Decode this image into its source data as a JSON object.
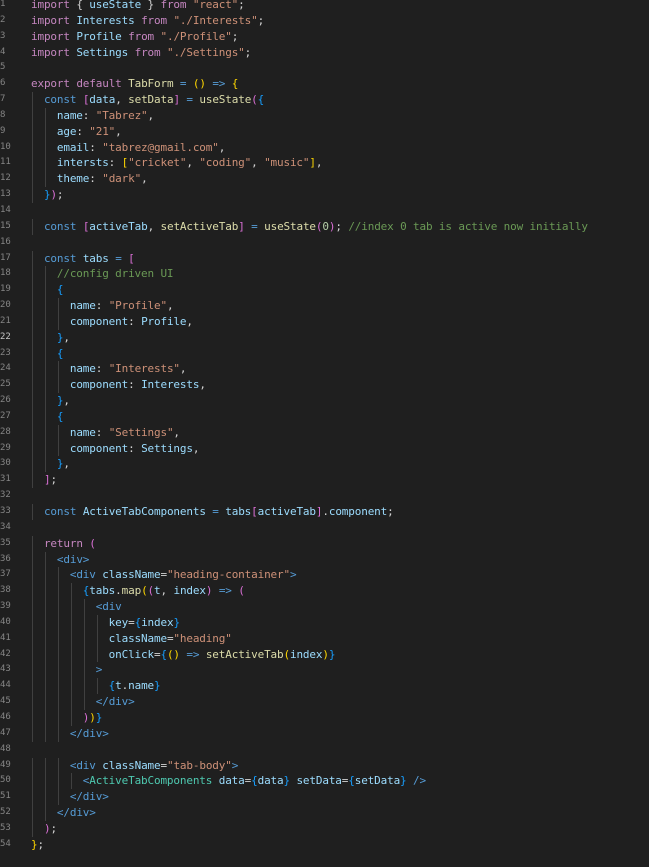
{
  "editor": {
    "language": "javascript",
    "theme": "dark",
    "current_line": 22,
    "colors": {
      "background": "#1f1f1f",
      "line_number": "#858585",
      "text": "#d4d4d4",
      "keyword_control": "#c586c0",
      "keyword": "#569cd6",
      "variable": "#9cdcfe",
      "function": "#dcdcaa",
      "string": "#ce9178",
      "number": "#b5cea8",
      "comment": "#6a9955",
      "component": "#4ec9b0",
      "tag": "#569cd6",
      "bracket_1": "#ffd700",
      "bracket_2": "#da70d6",
      "bracket_3": "#179fff"
    },
    "lines": [
      [
        [
          "import",
          "kc"
        ],
        [
          " { ",
          "p"
        ],
        [
          "useState",
          "v"
        ],
        [
          " } ",
          "p"
        ],
        [
          "from",
          "kc"
        ],
        [
          " ",
          "p"
        ],
        [
          "\"react\"",
          "s"
        ],
        [
          ";",
          "p"
        ]
      ],
      [
        [
          "import",
          "kc"
        ],
        [
          " ",
          "p"
        ],
        [
          "Interests",
          "v"
        ],
        [
          " ",
          "p"
        ],
        [
          "from",
          "kc"
        ],
        [
          " ",
          "p"
        ],
        [
          "\"./Interests\"",
          "s"
        ],
        [
          ";",
          "p"
        ]
      ],
      [
        [
          "import",
          "kc"
        ],
        [
          " ",
          "p"
        ],
        [
          "Profile",
          "v"
        ],
        [
          " ",
          "p"
        ],
        [
          "from",
          "kc"
        ],
        [
          " ",
          "p"
        ],
        [
          "\"./Profile\"",
          "s"
        ],
        [
          ";",
          "p"
        ]
      ],
      [
        [
          "import",
          "kc"
        ],
        [
          " ",
          "p"
        ],
        [
          "Settings",
          "v"
        ],
        [
          " ",
          "p"
        ],
        [
          "from",
          "kc"
        ],
        [
          " ",
          "p"
        ],
        [
          "\"./Settings\"",
          "s"
        ],
        [
          ";",
          "p"
        ]
      ],
      [],
      [
        [
          "export",
          "kc"
        ],
        [
          " ",
          "p"
        ],
        [
          "default",
          "kc"
        ],
        [
          " ",
          "p"
        ],
        [
          "TabForm",
          "f"
        ],
        [
          " ",
          "p"
        ],
        [
          "=",
          "k"
        ],
        [
          " ",
          "p"
        ],
        [
          "()",
          "b1"
        ],
        [
          " ",
          "p"
        ],
        [
          "=>",
          "k"
        ],
        [
          " ",
          "p"
        ],
        [
          "{",
          "b1"
        ]
      ],
      [
        [
          "  ",
          "p"
        ],
        [
          "const",
          "k"
        ],
        [
          " ",
          "p"
        ],
        [
          "[",
          "b2"
        ],
        [
          "data",
          "v"
        ],
        [
          ", ",
          "p"
        ],
        [
          "setData",
          "f"
        ],
        [
          "]",
          "b2"
        ],
        [
          " ",
          "p"
        ],
        [
          "=",
          "k"
        ],
        [
          " ",
          "p"
        ],
        [
          "useState",
          "f"
        ],
        [
          "(",
          "b2"
        ],
        [
          "{",
          "b3"
        ]
      ],
      [
        [
          "    ",
          "p"
        ],
        [
          "name",
          "v"
        ],
        [
          ": ",
          "p"
        ],
        [
          "\"Tabrez\"",
          "s"
        ],
        [
          ",",
          "p"
        ]
      ],
      [
        [
          "    ",
          "p"
        ],
        [
          "age",
          "v"
        ],
        [
          ": ",
          "p"
        ],
        [
          "\"21\"",
          "s"
        ],
        [
          ",",
          "p"
        ]
      ],
      [
        [
          "    ",
          "p"
        ],
        [
          "email",
          "v"
        ],
        [
          ": ",
          "p"
        ],
        [
          "\"tabrez@gmail.com\"",
          "s"
        ],
        [
          ",",
          "p"
        ]
      ],
      [
        [
          "    ",
          "p"
        ],
        [
          "intersts",
          "v"
        ],
        [
          ": ",
          "p"
        ],
        [
          "[",
          "b1"
        ],
        [
          "\"cricket\"",
          "s"
        ],
        [
          ", ",
          "p"
        ],
        [
          "\"coding\"",
          "s"
        ],
        [
          ", ",
          "p"
        ],
        [
          "\"music\"",
          "s"
        ],
        [
          "]",
          "b1"
        ],
        [
          ",",
          "p"
        ]
      ],
      [
        [
          "    ",
          "p"
        ],
        [
          "theme",
          "v"
        ],
        [
          ": ",
          "p"
        ],
        [
          "\"dark\"",
          "s"
        ],
        [
          ",",
          "p"
        ]
      ],
      [
        [
          "  ",
          "p"
        ],
        [
          "}",
          "b3"
        ],
        [
          ")",
          "b2"
        ],
        [
          ";",
          "p"
        ]
      ],
      [],
      [
        [
          "  ",
          "p"
        ],
        [
          "const",
          "k"
        ],
        [
          " ",
          "p"
        ],
        [
          "[",
          "b2"
        ],
        [
          "activeTab",
          "v"
        ],
        [
          ", ",
          "p"
        ],
        [
          "setActiveTab",
          "f"
        ],
        [
          "]",
          "b2"
        ],
        [
          " ",
          "p"
        ],
        [
          "=",
          "k"
        ],
        [
          " ",
          "p"
        ],
        [
          "useState",
          "f"
        ],
        [
          "(",
          "b2"
        ],
        [
          "0",
          "n"
        ],
        [
          ")",
          "b2"
        ],
        [
          "; ",
          "p"
        ],
        [
          "//index 0 tab is active now initially",
          "c"
        ]
      ],
      [],
      [
        [
          "  ",
          "p"
        ],
        [
          "const",
          "k"
        ],
        [
          " ",
          "p"
        ],
        [
          "tabs",
          "v"
        ],
        [
          " ",
          "p"
        ],
        [
          "=",
          "k"
        ],
        [
          " ",
          "p"
        ],
        [
          "[",
          "b2"
        ]
      ],
      [
        [
          "    ",
          "p"
        ],
        [
          "//config driven UI",
          "c"
        ]
      ],
      [
        [
          "    ",
          "p"
        ],
        [
          "{",
          "b3"
        ]
      ],
      [
        [
          "      ",
          "p"
        ],
        [
          "name",
          "v"
        ],
        [
          ": ",
          "p"
        ],
        [
          "\"Profile\"",
          "s"
        ],
        [
          ",",
          "p"
        ]
      ],
      [
        [
          "      ",
          "p"
        ],
        [
          "component",
          "v"
        ],
        [
          ": ",
          "p"
        ],
        [
          "Profile",
          "v"
        ],
        [
          ",",
          "p"
        ]
      ],
      [
        [
          "    ",
          "p"
        ],
        [
          "}",
          "b3"
        ],
        [
          ",",
          "p"
        ]
      ],
      [
        [
          "    ",
          "p"
        ],
        [
          "{",
          "b3"
        ]
      ],
      [
        [
          "      ",
          "p"
        ],
        [
          "name",
          "v"
        ],
        [
          ": ",
          "p"
        ],
        [
          "\"Interests\"",
          "s"
        ],
        [
          ",",
          "p"
        ]
      ],
      [
        [
          "      ",
          "p"
        ],
        [
          "component",
          "v"
        ],
        [
          ": ",
          "p"
        ],
        [
          "Interests",
          "v"
        ],
        [
          ",",
          "p"
        ]
      ],
      [
        [
          "    ",
          "p"
        ],
        [
          "}",
          "b3"
        ],
        [
          ",",
          "p"
        ]
      ],
      [
        [
          "    ",
          "p"
        ],
        [
          "{",
          "b3"
        ]
      ],
      [
        [
          "      ",
          "p"
        ],
        [
          "name",
          "v"
        ],
        [
          ": ",
          "p"
        ],
        [
          "\"Settings\"",
          "s"
        ],
        [
          ",",
          "p"
        ]
      ],
      [
        [
          "      ",
          "p"
        ],
        [
          "component",
          "v"
        ],
        [
          ": ",
          "p"
        ],
        [
          "Settings",
          "v"
        ],
        [
          ",",
          "p"
        ]
      ],
      [
        [
          "    ",
          "p"
        ],
        [
          "}",
          "b3"
        ],
        [
          ",",
          "p"
        ]
      ],
      [
        [
          "  ",
          "p"
        ],
        [
          "]",
          "b2"
        ],
        [
          ";",
          "p"
        ]
      ],
      [],
      [
        [
          "  ",
          "p"
        ],
        [
          "const",
          "k"
        ],
        [
          " ",
          "p"
        ],
        [
          "ActiveTabComponents",
          "v"
        ],
        [
          " ",
          "p"
        ],
        [
          "=",
          "k"
        ],
        [
          " ",
          "p"
        ],
        [
          "tabs",
          "v"
        ],
        [
          "[",
          "b2"
        ],
        [
          "activeTab",
          "v"
        ],
        [
          "]",
          "b2"
        ],
        [
          ".",
          "p"
        ],
        [
          "component",
          "v"
        ],
        [
          ";",
          "p"
        ]
      ],
      [],
      [
        [
          "  ",
          "p"
        ],
        [
          "return",
          "kc"
        ],
        [
          " ",
          "p"
        ],
        [
          "(",
          "b2"
        ]
      ],
      [
        [
          "    ",
          "p"
        ],
        [
          "<",
          "tg"
        ],
        [
          "div",
          "tg"
        ],
        [
          ">",
          "tg"
        ]
      ],
      [
        [
          "      ",
          "p"
        ],
        [
          "<",
          "tg"
        ],
        [
          "div",
          "tg"
        ],
        [
          " ",
          "p"
        ],
        [
          "className",
          "v"
        ],
        [
          "=",
          "p"
        ],
        [
          "\"heading-container\"",
          "s"
        ],
        [
          ">",
          "tg"
        ]
      ],
      [
        [
          "        ",
          "p"
        ],
        [
          "{",
          "b3"
        ],
        [
          "tabs",
          "v"
        ],
        [
          ".",
          "p"
        ],
        [
          "map",
          "f"
        ],
        [
          "(",
          "b1"
        ],
        [
          "(",
          "b2"
        ],
        [
          "t",
          "v"
        ],
        [
          ", ",
          "p"
        ],
        [
          "index",
          "v"
        ],
        [
          ")",
          "b2"
        ],
        [
          " ",
          "p"
        ],
        [
          "=>",
          "k"
        ],
        [
          " ",
          "p"
        ],
        [
          "(",
          "b2"
        ]
      ],
      [
        [
          "          ",
          "p"
        ],
        [
          "<",
          "tg"
        ],
        [
          "div",
          "tg"
        ]
      ],
      [
        [
          "            ",
          "p"
        ],
        [
          "key",
          "v"
        ],
        [
          "=",
          "p"
        ],
        [
          "{",
          "b3"
        ],
        [
          "index",
          "v"
        ],
        [
          "}",
          "b3"
        ]
      ],
      [
        [
          "            ",
          "p"
        ],
        [
          "className",
          "v"
        ],
        [
          "=",
          "p"
        ],
        [
          "\"heading\"",
          "s"
        ]
      ],
      [
        [
          "            ",
          "p"
        ],
        [
          "onClick",
          "v"
        ],
        [
          "=",
          "p"
        ],
        [
          "{",
          "b3"
        ],
        [
          "()",
          "b1"
        ],
        [
          " ",
          "p"
        ],
        [
          "=>",
          "k"
        ],
        [
          " ",
          "p"
        ],
        [
          "setActiveTab",
          "f"
        ],
        [
          "(",
          "b1"
        ],
        [
          "index",
          "v"
        ],
        [
          ")",
          "b1"
        ],
        [
          "}",
          "b3"
        ]
      ],
      [
        [
          "          ",
          "p"
        ],
        [
          ">",
          "tg"
        ]
      ],
      [
        [
          "            ",
          "p"
        ],
        [
          "{",
          "b3"
        ],
        [
          "t",
          "v"
        ],
        [
          ".",
          "p"
        ],
        [
          "name",
          "v"
        ],
        [
          "}",
          "b3"
        ]
      ],
      [
        [
          "          ",
          "p"
        ],
        [
          "</",
          "tg"
        ],
        [
          "div",
          "tg"
        ],
        [
          ">",
          "tg"
        ]
      ],
      [
        [
          "        ",
          "p"
        ],
        [
          ")",
          "b2"
        ],
        [
          ")",
          "b1"
        ],
        [
          "}",
          "b3"
        ]
      ],
      [
        [
          "      ",
          "p"
        ],
        [
          "</",
          "tg"
        ],
        [
          "div",
          "tg"
        ],
        [
          ">",
          "tg"
        ]
      ],
      [],
      [
        [
          "      ",
          "p"
        ],
        [
          "<",
          "tg"
        ],
        [
          "div",
          "tg"
        ],
        [
          " ",
          "p"
        ],
        [
          "className",
          "v"
        ],
        [
          "=",
          "p"
        ],
        [
          "\"tab-body\"",
          "s"
        ],
        [
          ">",
          "tg"
        ]
      ],
      [
        [
          "        ",
          "p"
        ],
        [
          "<",
          "tg"
        ],
        [
          "ActiveTabComponents",
          "cm"
        ],
        [
          " ",
          "p"
        ],
        [
          "data",
          "v"
        ],
        [
          "=",
          "p"
        ],
        [
          "{",
          "b3"
        ],
        [
          "data",
          "v"
        ],
        [
          "}",
          "b3"
        ],
        [
          " ",
          "p"
        ],
        [
          "setData",
          "v"
        ],
        [
          "=",
          "p"
        ],
        [
          "{",
          "b3"
        ],
        [
          "setData",
          "v"
        ],
        [
          "}",
          "b3"
        ],
        [
          " ",
          "p"
        ],
        [
          "/>",
          "tg"
        ]
      ],
      [
        [
          "      ",
          "p"
        ],
        [
          "</",
          "tg"
        ],
        [
          "div",
          "tg"
        ],
        [
          ">",
          "tg"
        ]
      ],
      [
        [
          "    ",
          "p"
        ],
        [
          "</",
          "tg"
        ],
        [
          "div",
          "tg"
        ],
        [
          ">",
          "tg"
        ]
      ],
      [
        [
          "  ",
          "p"
        ],
        [
          ")",
          "b2"
        ],
        [
          ";",
          "p"
        ]
      ],
      [
        [
          "}",
          "b1"
        ],
        [
          ";",
          "p"
        ]
      ]
    ]
  }
}
